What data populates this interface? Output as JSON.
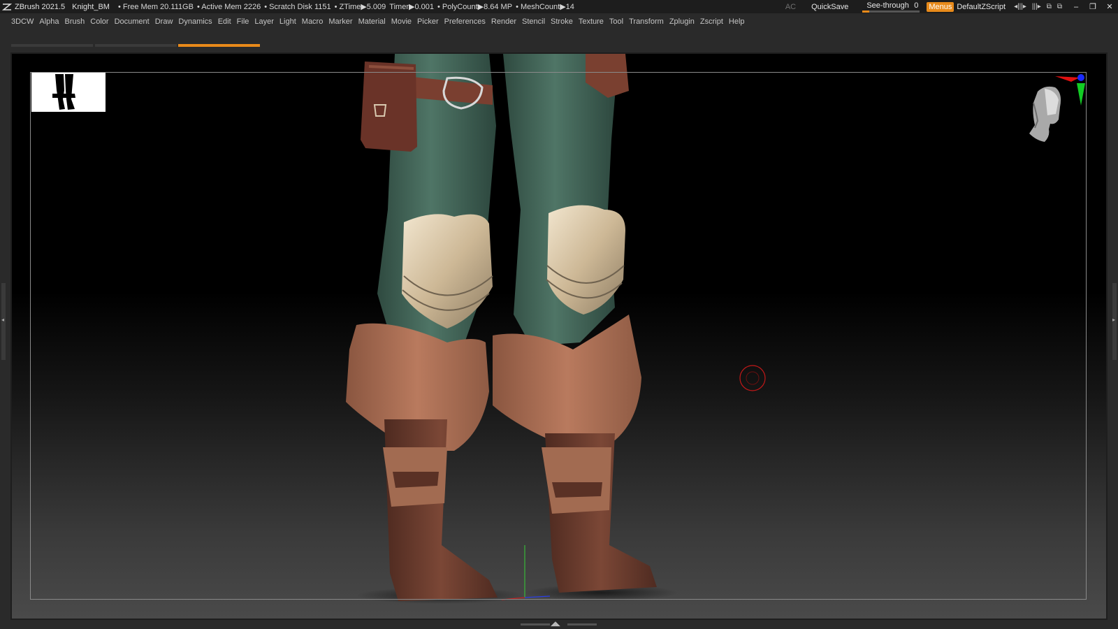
{
  "titlebar": {
    "app": "ZBrush 2021.5",
    "document": "Knight_BM",
    "stats": [
      "• Free Mem 20.111GB",
      "• Active Mem 2226",
      "• Scratch Disk 1151",
      "• ZTime▶5.009",
      "Timer▶0.001",
      "• PolyCount▶8.64 MP",
      "• MeshCount▶14"
    ],
    "ac": "AC",
    "quicksave": "QuickSave",
    "see_through": {
      "label": "See-through",
      "value": "0",
      "level": 0.0
    },
    "menus": "Menus",
    "script": "DefaultZScript",
    "icons": [
      "◂|||▸",
      "|||▸",
      "⧉",
      "⧉"
    ],
    "window_controls": [
      "–",
      "❐",
      "✕"
    ]
  },
  "menubar": {
    "items": [
      "3DCW",
      "Alpha",
      "Brush",
      "Color",
      "Document",
      "Draw",
      "Dynamics",
      "Edit",
      "File",
      "Layer",
      "Light",
      "Macro",
      "Marker",
      "Material",
      "Movie",
      "Picker",
      "Preferences",
      "Render",
      "Stencil",
      "Stroke",
      "Texture",
      "Tool",
      "Transform",
      "Zplugin",
      "Zscript",
      "Help"
    ]
  },
  "shelf": {
    "segments": 3,
    "active_index": 2
  },
  "colors": {
    "accent": "#e88a1a",
    "pants": "#4a6e60",
    "leather": "#b57559",
    "boot": "#6b3d2e",
    "kneepad": "#d9c7a8",
    "brush_cursor": "#c21818"
  },
  "bottombar": {
    "arrows": "◢◣"
  }
}
